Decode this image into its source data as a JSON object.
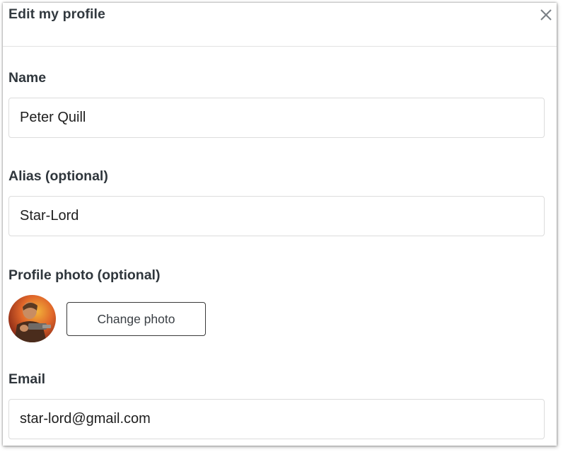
{
  "dialog": {
    "title": "Edit my profile",
    "close_icon": "close-icon"
  },
  "form": {
    "name": {
      "label": "Name",
      "value": "Peter Quill"
    },
    "alias": {
      "label": "Alias (optional)",
      "value": "Star-Lord"
    },
    "photo": {
      "label": "Profile photo (optional)",
      "change_label": "Change photo"
    },
    "email": {
      "label": "Email",
      "value": "star-lord@gmail.com"
    }
  },
  "colors": {
    "text": "#2f363c",
    "border": "#dcdcdc",
    "button_border": "#3a3a3a",
    "close_icon": "#7a7f85"
  }
}
